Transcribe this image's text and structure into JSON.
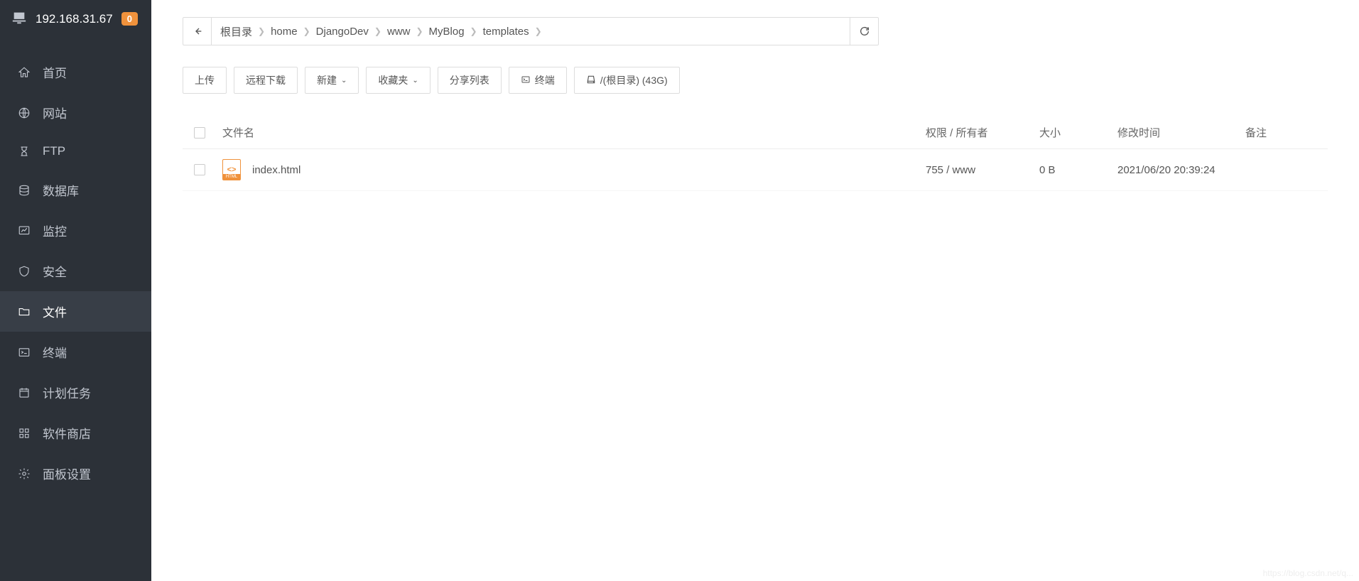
{
  "sidebar": {
    "ip": "192.168.31.67",
    "badge": "0",
    "items": [
      {
        "label": "首页",
        "icon": "home"
      },
      {
        "label": "网站",
        "icon": "globe"
      },
      {
        "label": "FTP",
        "icon": "ftp"
      },
      {
        "label": "数据库",
        "icon": "database"
      },
      {
        "label": "监控",
        "icon": "monitor"
      },
      {
        "label": "安全",
        "icon": "shield"
      },
      {
        "label": "文件",
        "icon": "folder",
        "active": true
      },
      {
        "label": "终端",
        "icon": "terminal"
      },
      {
        "label": "计划任务",
        "icon": "calendar"
      },
      {
        "label": "软件商店",
        "icon": "apps"
      },
      {
        "label": "面板设置",
        "icon": "gear"
      }
    ]
  },
  "breadcrumb": {
    "segments": [
      "根目录",
      "home",
      "DjangoDev",
      "www",
      "MyBlog",
      "templates"
    ]
  },
  "toolbar": {
    "upload": "上传",
    "remote_download": "远程下载",
    "new": "新建",
    "favorites": "收藏夹",
    "share_list": "分享列表",
    "terminal": "终端",
    "disk_label": "/(根目录) (43G)"
  },
  "table": {
    "headers": {
      "name": "文件名",
      "perm": "权限 / 所有者",
      "size": "大小",
      "mtime": "修改时间",
      "remark": "备注"
    },
    "rows": [
      {
        "name": "index.html",
        "perm": "755 / www",
        "size": "0 B",
        "mtime": "2021/06/20 20:39:24",
        "remark": ""
      }
    ]
  },
  "watermark": "https://blog.csdn.net/q..."
}
